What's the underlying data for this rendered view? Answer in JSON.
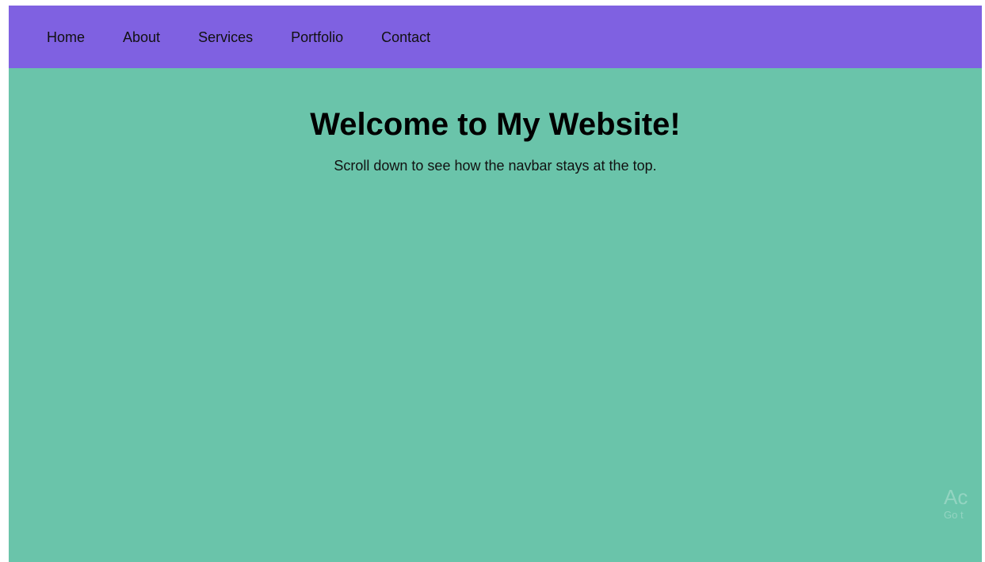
{
  "navbar": {
    "background": "#7f61e1",
    "items": [
      {
        "label": "Home"
      },
      {
        "label": "About"
      },
      {
        "label": "Services"
      },
      {
        "label": "Portfolio"
      },
      {
        "label": "Contact"
      }
    ]
  },
  "hero": {
    "background": "#6ac4aa",
    "title": "Welcome to My Website!",
    "subtitle": "Scroll down to see how the navbar stays at the top."
  },
  "watermark": {
    "title": "Ac",
    "subtitle": "Go t"
  }
}
